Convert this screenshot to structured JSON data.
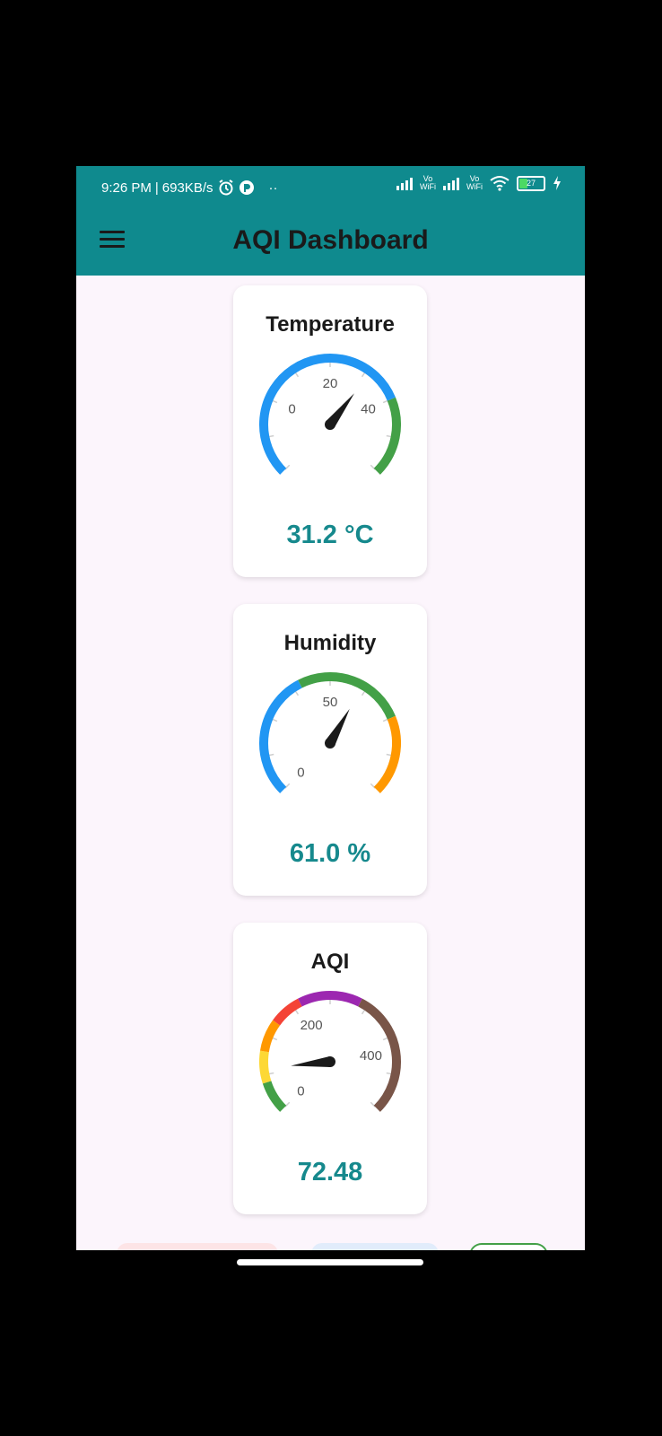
{
  "status_bar": {
    "time": "9:26 PM",
    "speed": "693KB/s",
    "icons": [
      "alarm-icon",
      "app-notification-icon",
      "more-dots-icon",
      "signal-icon",
      "vowifi-icon",
      "signal-icon",
      "vowifi-icon",
      "wifi-icon",
      "battery-icon",
      "charging-icon"
    ],
    "vowifi_label_top": "Vo",
    "vowifi_label_bottom": "WiFi",
    "battery_level": "27",
    "dots": "··"
  },
  "app_bar": {
    "title": "AQI Dashboard",
    "menu_icon": "hamburger-menu-icon",
    "color": "#0f8a8e"
  },
  "gauges": [
    {
      "id": "temperature",
      "title": "Temperature",
      "value_text": "31.2 °C",
      "value": 31.2,
      "min": -20,
      "max": 60,
      "tick_labels": [
        {
          "text": "0",
          "value": 0
        },
        {
          "text": "20",
          "value": 20
        },
        {
          "text": "40",
          "value": 40
        }
      ],
      "bands": [
        {
          "from": -20,
          "to": 40,
          "color": "#2196f3"
        },
        {
          "from": 40,
          "to": 60,
          "color": "#43a047"
        }
      ]
    },
    {
      "id": "humidity",
      "title": "Humidity",
      "value_text": "61.0 %",
      "value": 61.0,
      "min": 0,
      "max": 100,
      "tick_labels": [
        {
          "text": "0",
          "value": 0
        },
        {
          "text": "50",
          "value": 50
        }
      ],
      "bands": [
        {
          "from": 0,
          "to": 40,
          "color": "#2196f3"
        },
        {
          "from": 40,
          "to": 75,
          "color": "#43a047"
        },
        {
          "from": 75,
          "to": 100,
          "color": "#ff9800"
        }
      ]
    },
    {
      "id": "aqi",
      "title": "AQI",
      "value_text": "72.48",
      "value": 72.48,
      "min": 0,
      "max": 500,
      "tick_labels": [
        {
          "text": "0",
          "value": 0
        },
        {
          "text": "200",
          "value": 200
        },
        {
          "text": "400",
          "value": 400
        }
      ],
      "bands": [
        {
          "from": 0,
          "to": 50,
          "color": "#43a047"
        },
        {
          "from": 50,
          "to": 100,
          "color": "#fdd835"
        },
        {
          "from": 100,
          "to": 150,
          "color": "#ff9800"
        },
        {
          "from": 150,
          "to": 200,
          "color": "#f44336"
        },
        {
          "from": 200,
          "to": 300,
          "color": "#9c27b0"
        },
        {
          "from": 300,
          "to": 500,
          "color": "#795548"
        }
      ]
    }
  ],
  "colors": {
    "value_text": "#16898d",
    "background": "#fcf5fc",
    "needle": "#1a1a1a"
  }
}
